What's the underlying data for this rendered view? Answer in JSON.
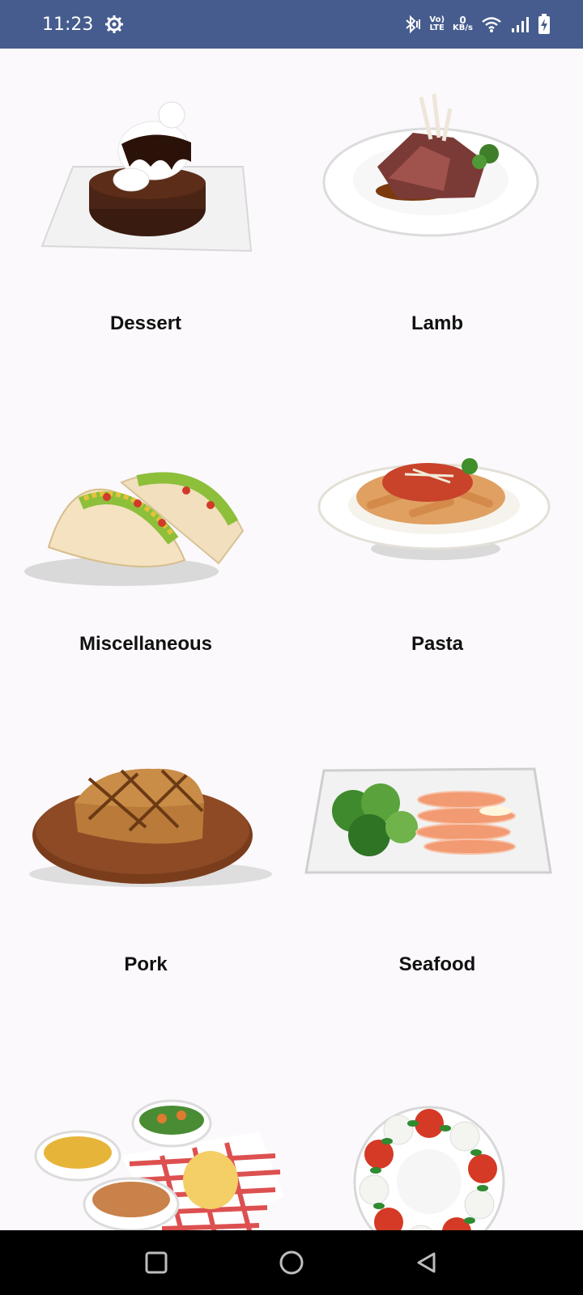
{
  "status_bar": {
    "time": "11:23",
    "icons": [
      "settings-gear-icon",
      "bluetooth-icon",
      "volte-icon",
      "data-speed-indicator",
      "wifi-icon",
      "cellular-signal-icon",
      "battery-charging-icon"
    ],
    "volte_top": "Vo)",
    "volte_bottom": "LTE",
    "data_speed_value": "0",
    "data_speed_unit": "KB/s"
  },
  "categories": [
    {
      "label": "Dessert",
      "icon": "dessert-brownie-image"
    },
    {
      "label": "Lamb",
      "icon": "lamb-chops-image"
    },
    {
      "label": "Miscellaneous",
      "icon": "tacos-image"
    },
    {
      "label": "Pasta",
      "icon": "penne-pasta-image"
    },
    {
      "label": "Pork",
      "icon": "pork-chop-image"
    },
    {
      "label": "Seafood",
      "icon": "salmon-plate-image"
    },
    {
      "label": "",
      "icon": "side-dishes-image"
    },
    {
      "label": "",
      "icon": "caprese-salad-image"
    }
  ],
  "nav_bar": {
    "icons": [
      "recents-square-icon",
      "home-circle-icon",
      "back-triangle-icon"
    ]
  },
  "colors": {
    "status_bar": "#465c8e",
    "background": "#fcf9fc",
    "nav_bar": "#000000"
  }
}
